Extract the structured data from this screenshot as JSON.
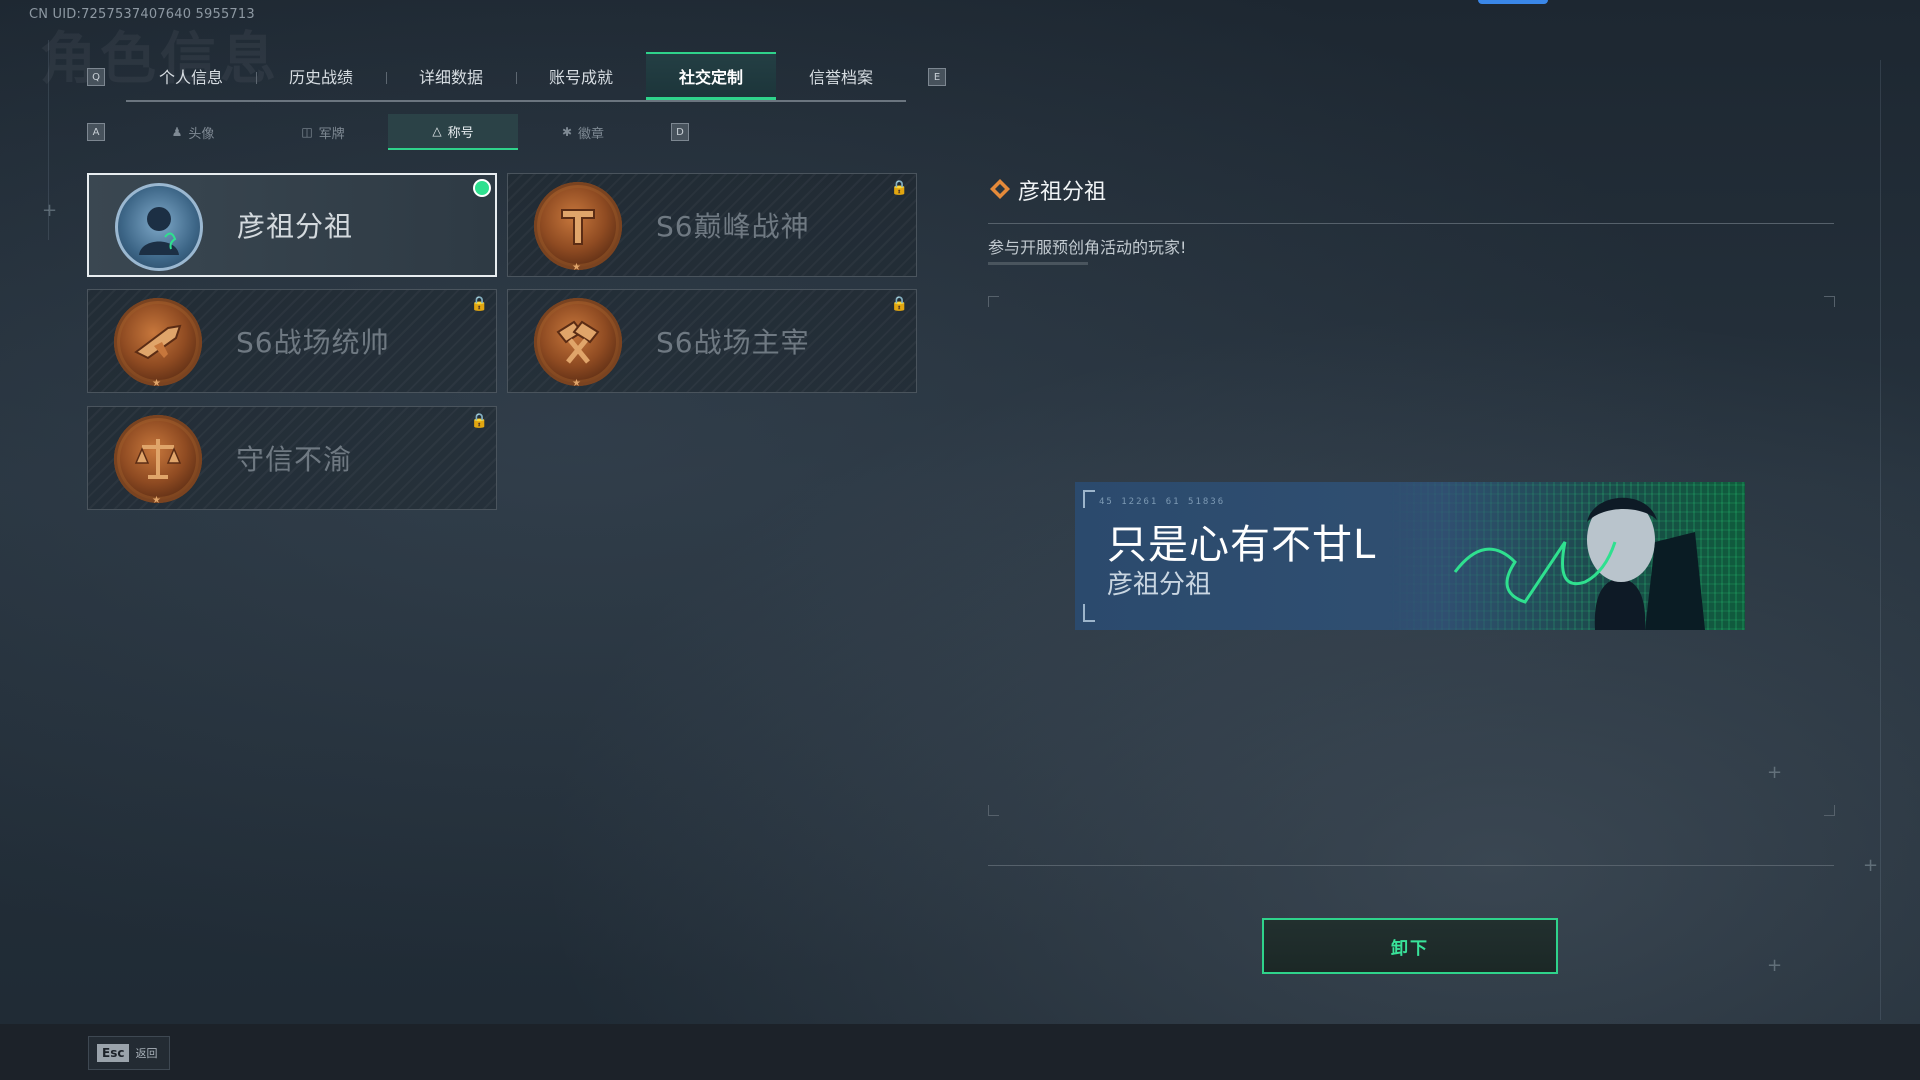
{
  "header": {
    "uid": "CN UID:7257537407640 5955713",
    "ghost_title": "角色信息"
  },
  "tabs": {
    "prev_key": "Q",
    "next_key": "E",
    "items": [
      {
        "label": "个人信息"
      },
      {
        "label": "历史战绩"
      },
      {
        "label": "详细数据"
      },
      {
        "label": "账号成就"
      },
      {
        "label": "社交定制",
        "active": true
      },
      {
        "label": "信誉档案"
      }
    ]
  },
  "subtabs": {
    "prev_key": "A",
    "next_key": "D",
    "items": [
      {
        "label": "头像",
        "icon": "person-icon"
      },
      {
        "label": "军牌",
        "icon": "dogtag-icon"
      },
      {
        "label": "称号",
        "icon": "triangle-icon",
        "active": true
      },
      {
        "label": "徽章",
        "icon": "badge-icon"
      }
    ]
  },
  "titles": [
    {
      "name": "彦祖分祖",
      "state": "equipped",
      "emblem": "portrait-emblem-icon"
    },
    {
      "name": "S6巅峰战神",
      "state": "locked",
      "emblem": "bronze-t-emblem-icon"
    },
    {
      "name": "S6战场统帅",
      "state": "locked",
      "emblem": "bronze-jet-emblem-icon"
    },
    {
      "name": "S6战场主宰",
      "state": "locked",
      "emblem": "bronze-hammers-emblem-icon"
    },
    {
      "name": "守信不渝",
      "state": "locked",
      "emblem": "bronze-scales-emblem-icon"
    }
  ],
  "detail": {
    "title": "彦祖分祖",
    "description": "参与开服预创角活动的玩家!"
  },
  "banner": {
    "code": "45 12261   61 51836",
    "quote": "只是心有不甘L",
    "subtitle": "彦祖分祖"
  },
  "actions": {
    "unequip_label": "卸下"
  },
  "footer": {
    "esc_key": "Esc",
    "back_label": "返回"
  },
  "colors": {
    "accent": "#2fd38b",
    "bronze": "#8f4b22",
    "equipped_dot": "#2fe08f"
  }
}
